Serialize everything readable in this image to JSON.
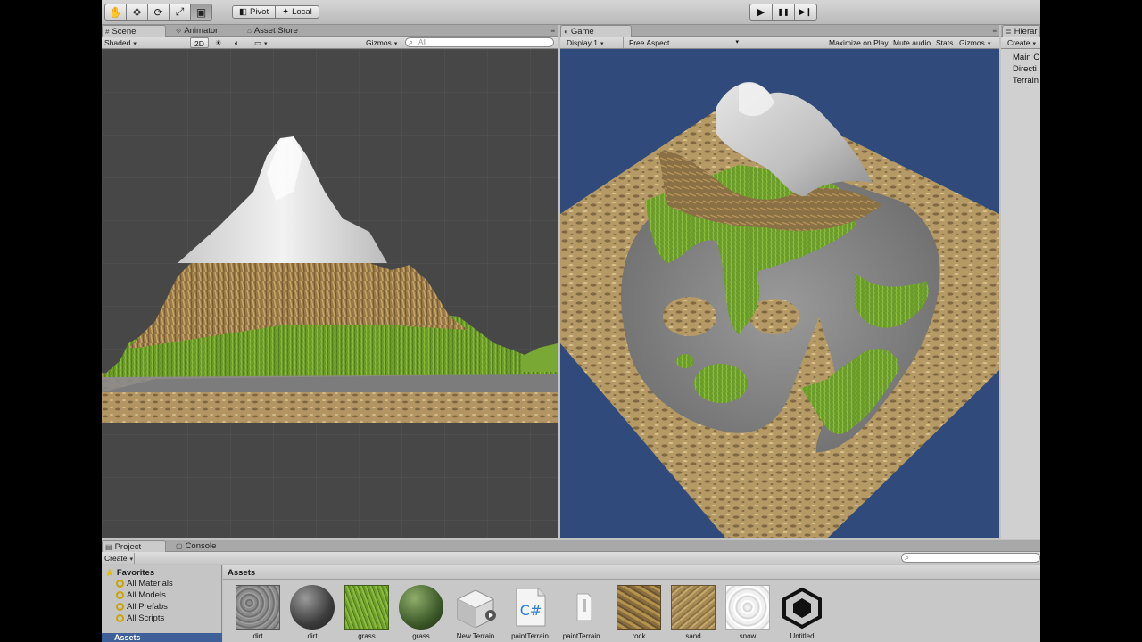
{
  "toolbar": {
    "tools": [
      {
        "name": "hand-tool",
        "glyph": "✋"
      },
      {
        "name": "move-tool",
        "glyph": "✥"
      },
      {
        "name": "rotate-tool",
        "glyph": "⟳"
      },
      {
        "name": "scale-tool",
        "glyph": "⤢"
      },
      {
        "name": "rect-tool",
        "glyph": "▣"
      }
    ],
    "pivot_label": "Pivot",
    "local_label": "Local",
    "play_glyph": "▶",
    "pause_glyph": "❚❚",
    "step_glyph": "▶❙"
  },
  "scene": {
    "tabs": [
      "Scene",
      "Animator",
      "Asset Store"
    ],
    "shading": "Shaded",
    "mode_2d": "2D",
    "gizmos": "Gizmos",
    "search_placeholder": "All"
  },
  "game": {
    "tab": "Game",
    "display": "Display 1",
    "aspect": "Free Aspect",
    "maximize": "Maximize on Play",
    "mute": "Mute audio",
    "stats": "Stats",
    "gizmos": "Gizmos"
  },
  "hierarchy": {
    "tab": "Hierar",
    "create": "Create",
    "items": [
      "Main C",
      "Directi",
      "Terrain"
    ]
  },
  "project": {
    "tabs": [
      "Project",
      "Console"
    ],
    "create": "Create",
    "favorites_title": "Favorites",
    "favorites": [
      "All Materials",
      "All Models",
      "All Prefabs",
      "All Scripts"
    ],
    "assets_root": "Assets",
    "assets_title": "Assets",
    "assets": [
      {
        "label": "dirt",
        "kind": "tex-dirt"
      },
      {
        "label": "dirt",
        "kind": "sphere-dirt"
      },
      {
        "label": "grass",
        "kind": "tex-grass"
      },
      {
        "label": "grass",
        "kind": "sphere-grass"
      },
      {
        "label": "New Terrain",
        "kind": "terrain"
      },
      {
        "label": "paintTerrain",
        "kind": "csharp"
      },
      {
        "label": "paintTerrain...",
        "kind": "file"
      },
      {
        "label": "rock",
        "kind": "tex-rock"
      },
      {
        "label": "sand",
        "kind": "tex-sand"
      },
      {
        "label": "snow",
        "kind": "tex-snow"
      },
      {
        "label": "Untitled",
        "kind": "unity"
      }
    ]
  },
  "colors": {
    "game_sky": "#2f4a7b",
    "scene_bg": "#474747",
    "selection": "#3f5f99"
  }
}
